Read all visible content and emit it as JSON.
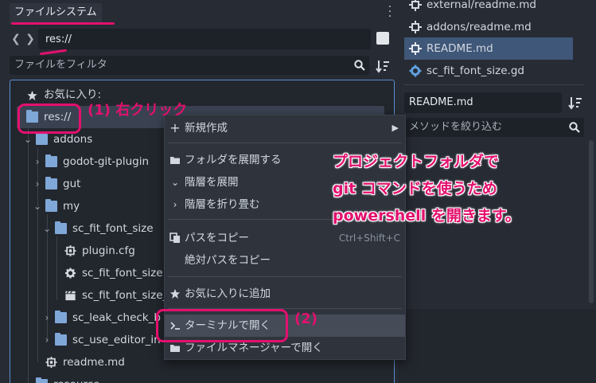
{
  "filesystem": {
    "tab_label": "ファイルシステム",
    "path": "res://",
    "filter_placeholder": "ファイルをフィルタ",
    "favorites_label": "お気に入り:",
    "tree": [
      {
        "label": "res://",
        "kind": "folder"
      },
      {
        "label": "addons",
        "kind": "folder"
      },
      {
        "label": "godot-git-plugin",
        "kind": "folder"
      },
      {
        "label": "gut",
        "kind": "folder"
      },
      {
        "label": "my",
        "kind": "folder"
      },
      {
        "label": "sc_fit_font_size",
        "kind": "folder"
      },
      {
        "label": "plugin.cfg",
        "kind": "config"
      },
      {
        "label": "sc_fit_font_size.g",
        "kind": "script"
      },
      {
        "label": "sc_fit_font_size_",
        "kind": "scene"
      },
      {
        "label": "sc_leak_check_b",
        "kind": "folder"
      },
      {
        "label": "sc_use_editor_in",
        "kind": "folder"
      },
      {
        "label": "readme.md",
        "kind": "doc"
      },
      {
        "label": "resource",
        "kind": "folder"
      }
    ]
  },
  "scripts": {
    "items": [
      {
        "label": "external/readme.md",
        "icon": "doc-icon"
      },
      {
        "label": "addons/readme.md",
        "icon": "doc-icon"
      },
      {
        "label": "README.md",
        "icon": "doc-icon",
        "selected": true
      },
      {
        "label": "sc_fit_font_size.gd",
        "icon": "gear-icon"
      }
    ],
    "current_title": "README.md",
    "method_filter_placeholder": "メソッドを絞り込む"
  },
  "context_menu": {
    "items": [
      {
        "label": "新規作成",
        "icon": "plus-icon",
        "submenu": true
      },
      {
        "label": "フォルダを展開する",
        "icon": "folder-open-icon"
      },
      {
        "label": "階層を展開",
        "icon": "chevron-down-icon"
      },
      {
        "label": "階層を折り畳む",
        "icon": "chevron-right-icon"
      },
      {
        "label": "パスをコピー",
        "icon": "copy-icon",
        "shortcut": "Ctrl+Shift+C"
      },
      {
        "label": "絶対パスをコピー",
        "icon": ""
      },
      {
        "label": "お気に入りに追加",
        "icon": "star-icon"
      },
      {
        "label": "ターミナルで開く",
        "icon": "terminal-icon"
      },
      {
        "label": "ファイルマネージャーで開く",
        "icon": "folder-icon"
      }
    ]
  },
  "annotations": {
    "step1": "(1) 右クリック",
    "step2": "(2)",
    "note_lines": [
      "プロジェクトフォルダで",
      "git コマンドを使うため",
      "powershell を開きます。"
    ],
    "color": "#e3106e"
  },
  "colors": {
    "accent_blue": "#5a8fd0",
    "selection": "#3f5778",
    "folder": "#7fa7d8"
  }
}
